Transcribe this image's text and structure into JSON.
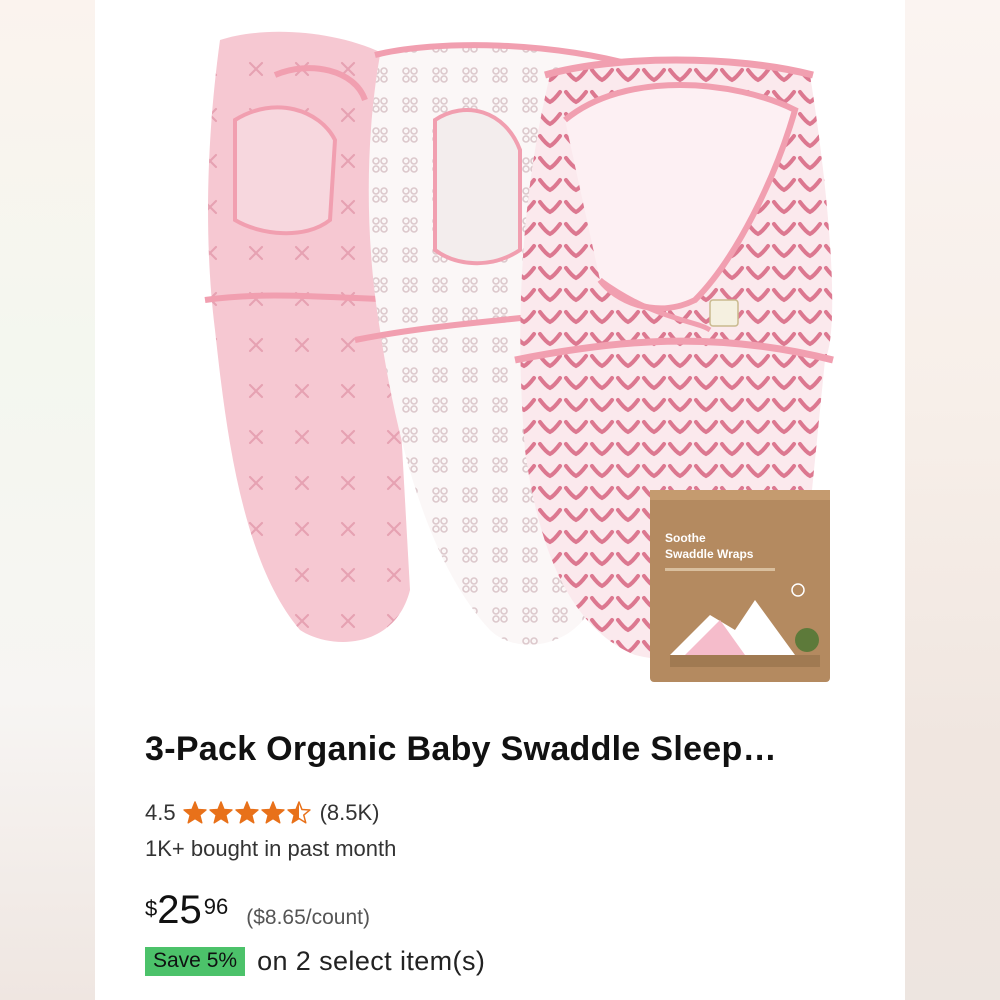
{
  "product": {
    "image_alt": "3-pack pink, white and pink leaf-pattern swaddle wraps with box",
    "box_label_line1": "Soothe",
    "box_label_line2": "Swaddle Wraps",
    "title": "3-Pack Organic Baby Swaddle Sleep…",
    "rating": {
      "value": 4.5,
      "value_text": "4.5",
      "count": "(8.5K)",
      "star_color": "#e8711a"
    },
    "bought": "1K+ bought in past month",
    "price": {
      "symbol": "$",
      "whole": "25",
      "fraction": "96",
      "unit_price": "($8.65/count)"
    },
    "promo": {
      "badge": "Save 5%",
      "text": "on 2 select item(s)",
      "badge_color": "#4cc26a"
    }
  }
}
